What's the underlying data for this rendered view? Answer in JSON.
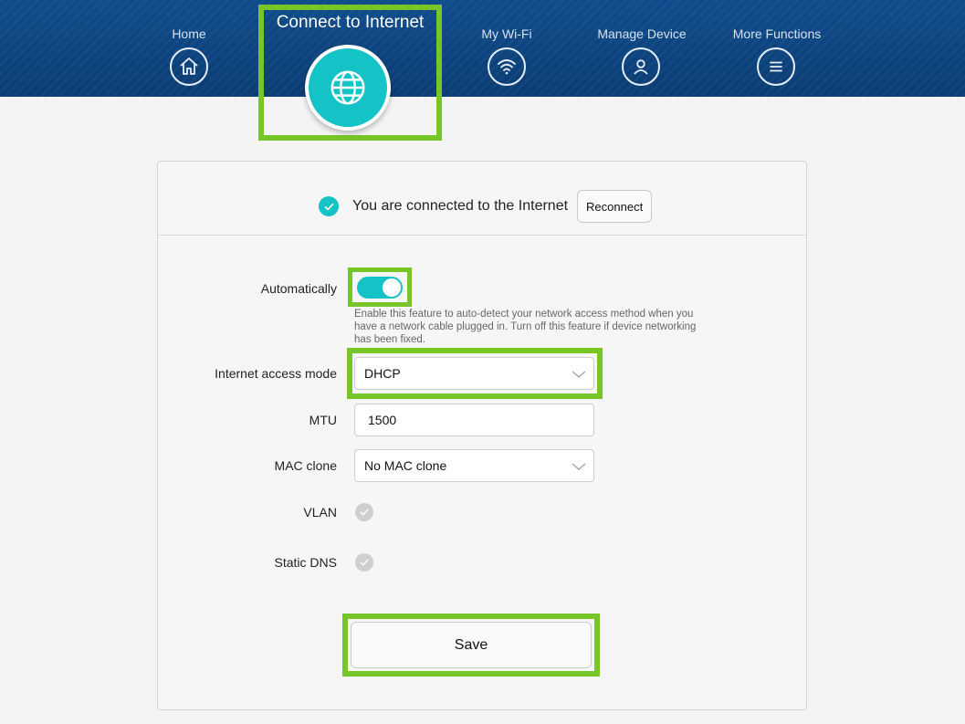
{
  "nav": {
    "home": "Home",
    "connect": "Connect to Internet",
    "wifi": "My Wi-Fi",
    "manage": "Manage Device",
    "more": "More Functions"
  },
  "status": {
    "text": "You are connected to the Internet",
    "reconnect": "Reconnect"
  },
  "form": {
    "auto_label": "Automatically",
    "auto_enabled": true,
    "auto_hint": "Enable this feature to auto-detect your network access method when you have a network cable plugged in. Turn off this feature if device networking has been fixed.",
    "mode_label": "Internet access mode",
    "mode_value": "DHCP",
    "mtu_label": "MTU",
    "mtu_value": "1500",
    "mac_label": "MAC clone",
    "mac_value": "No MAC clone",
    "vlan_label": "VLAN",
    "dns_label": "Static DNS",
    "save": "Save"
  },
  "colors": {
    "accent": "#14c3c6",
    "highlight": "#77c526",
    "header": "#0f4c8c"
  },
  "icons": [
    "home-icon",
    "globe-icon",
    "wifi-icon",
    "user-icon",
    "menu-icon",
    "check-icon",
    "chevron-down-icon"
  ]
}
